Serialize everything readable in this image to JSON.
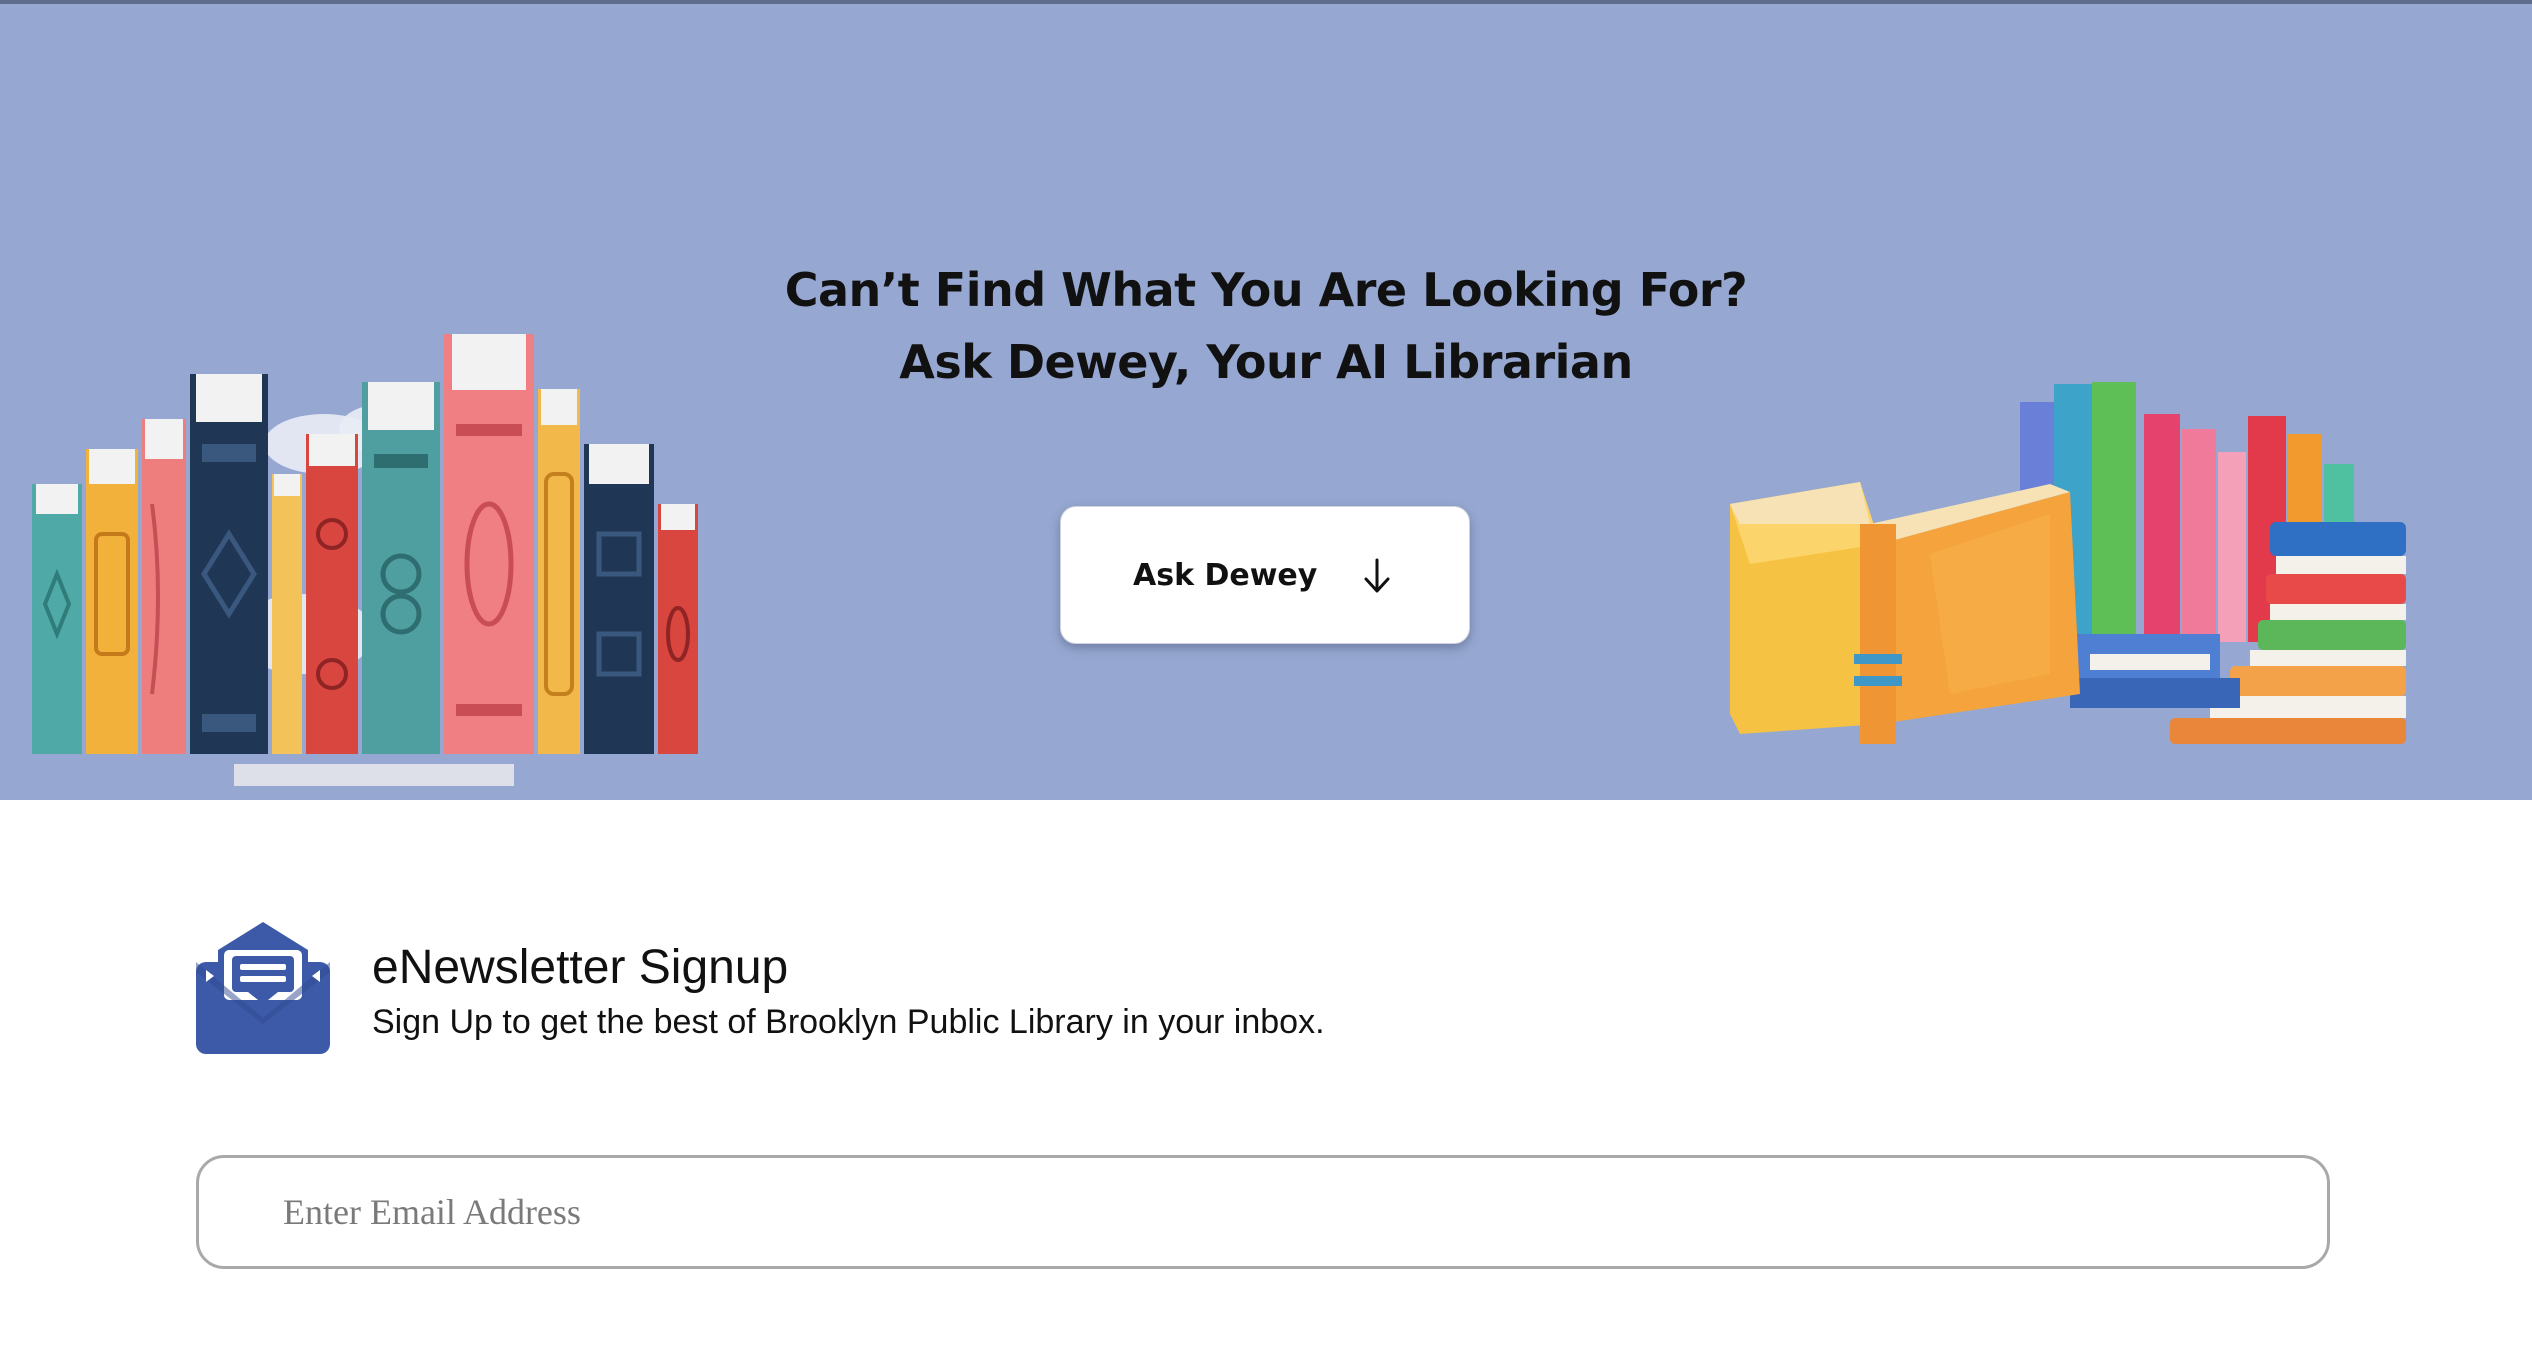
{
  "hero": {
    "title_line1": "Can’t Find What You Are Looking For?",
    "title_line2": "Ask Dewey, Your AI Librarian",
    "background_color": "#96a8d1",
    "ask_button": {
      "label": "Ask Dewey",
      "icon": "arrow-down-icon"
    }
  },
  "newsletter": {
    "icon": "envelope-icon",
    "title": "eNewsletter Signup",
    "subtitle": "Sign Up to get the best of Brooklyn Public Library in your inbox.",
    "email_input": {
      "value": "",
      "placeholder": "Enter Email Address"
    },
    "accent_color": "#3c5aa8"
  }
}
